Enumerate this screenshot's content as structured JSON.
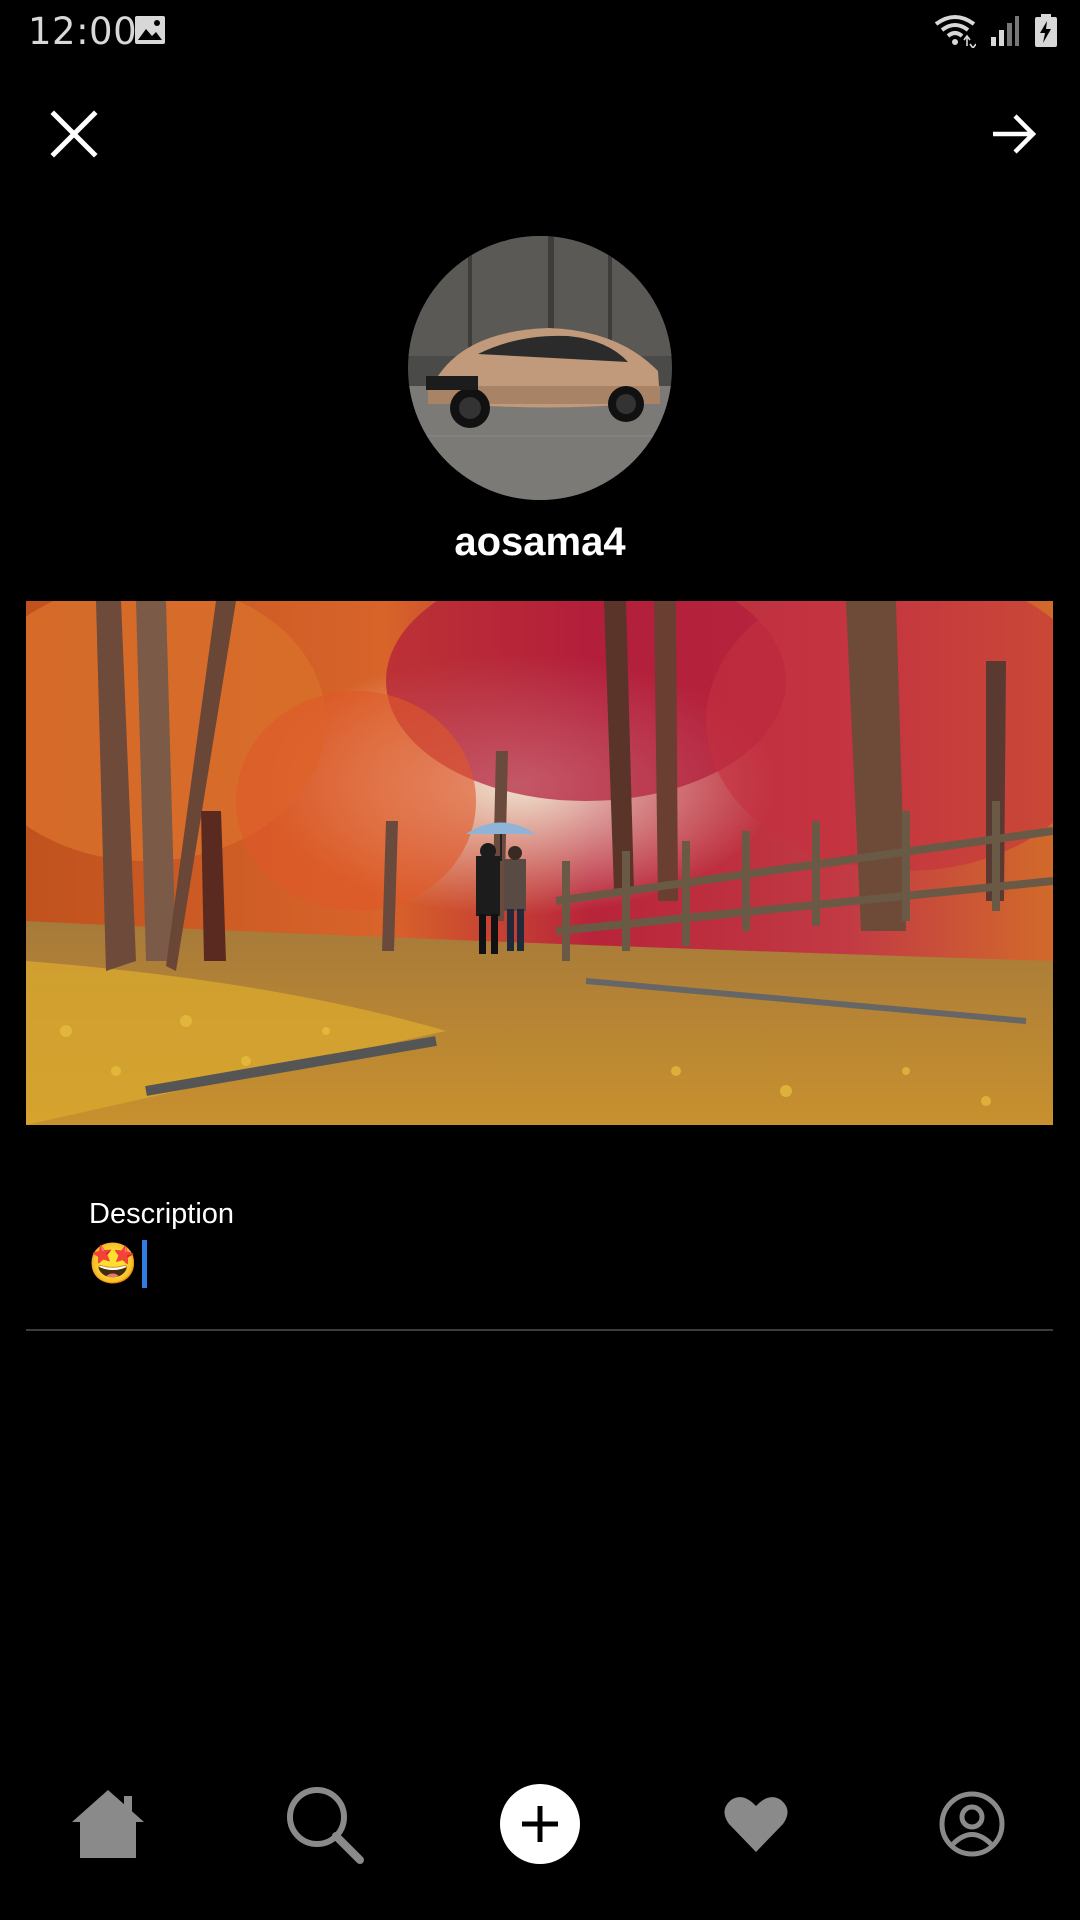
{
  "status_bar": {
    "time": "12:00",
    "icons": [
      "image-icon",
      "wifi-icon",
      "signal-icon",
      "battery-icon"
    ]
  },
  "header": {
    "close_icon": "close-icon",
    "next_icon": "arrow-right-icon"
  },
  "profile": {
    "username": "aosama4",
    "avatar_description": "car-photo"
  },
  "post": {
    "image_description": "autumn-forest-path"
  },
  "description_field": {
    "label": "Description",
    "value": "🤩"
  },
  "bottom_nav": {
    "items": [
      {
        "icon": "home-icon"
      },
      {
        "icon": "search-icon"
      },
      {
        "icon": "add-icon"
      },
      {
        "icon": "heart-icon"
      },
      {
        "icon": "profile-icon"
      }
    ]
  },
  "colors": {
    "background": "#000000",
    "caret": "#2f7de1",
    "inactive_icon": "#8a8a8a",
    "divider": "#3c3c3c"
  }
}
